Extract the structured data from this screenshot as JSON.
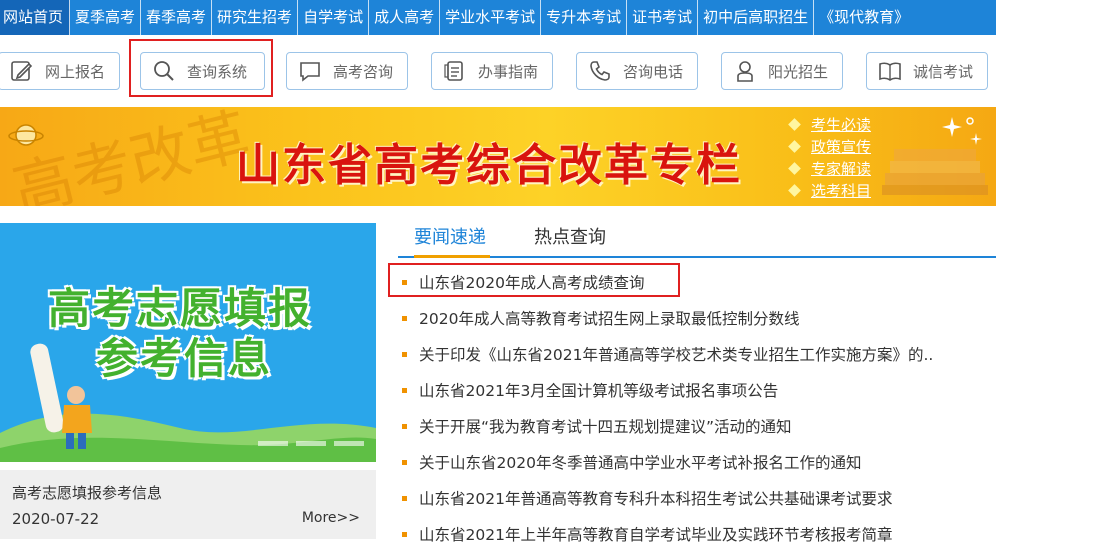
{
  "nav": {
    "items": [
      {
        "label": "网站首页",
        "active": true
      },
      {
        "label": "夏季高考"
      },
      {
        "label": "春季高考"
      },
      {
        "label": "研究生招考"
      },
      {
        "label": "自学考试"
      },
      {
        "label": "成人高考"
      },
      {
        "label": "学业水平考试"
      },
      {
        "label": "专升本考试"
      },
      {
        "label": "证书考试"
      },
      {
        "label": "初中后高职招生"
      },
      {
        "label": "《现代教育》"
      }
    ]
  },
  "quick_buttons": [
    {
      "label": "网上报名",
      "icon": "pencil-icon"
    },
    {
      "label": "查询系统",
      "icon": "search-icon"
    },
    {
      "label": "高考咨询",
      "icon": "chat-bubble-icon"
    },
    {
      "label": "办事指南",
      "icon": "document-icon"
    },
    {
      "label": "咨询电话",
      "icon": "phone-icon"
    },
    {
      "label": "阳光招生",
      "icon": "person-icon"
    },
    {
      "label": "诚信考试",
      "icon": "book-icon"
    }
  ],
  "banner": {
    "title": "山东省高考综合改革专栏",
    "ghost_text": "高考改革",
    "links": [
      "考生必读",
      "政策宣传",
      "专家解读",
      "选考科目"
    ]
  },
  "feature": {
    "image_line1": "高考志愿填报",
    "image_line2": "参考信息",
    "caption_title": "高考志愿填报参考信息",
    "caption_date": "2020-07-22",
    "more_label": "More>>"
  },
  "tabs": [
    {
      "label": "要闻速递",
      "active": true
    },
    {
      "label": "热点查询"
    }
  ],
  "news": [
    "山东省2020年成人高考成绩查询",
    "2020年成人高等教育考试招生网上录取最低控制分数线",
    "关于印发《山东省2021年普通高等学校艺术类专业招生工作实施方案》的..",
    "山东省2021年3月全国计算机等级考试报名事项公告",
    "关于开展“我为教育考试十四五规划提建议”活动的通知",
    "关于山东省2020年冬季普通高中学业水平考试补报名工作的通知",
    "山东省2021年普通高等教育专科升本科招生考试公共基础课考试要求",
    "山东省2021年上半年高等教育自学考试毕业及实践环节考核报考简章"
  ],
  "colors": {
    "nav_bg": "#1e84d8",
    "highlight_box": "#e02020",
    "banner_title": "#d9140e",
    "bullet": "#f09200",
    "feature_bg": "#2aa6ea"
  }
}
